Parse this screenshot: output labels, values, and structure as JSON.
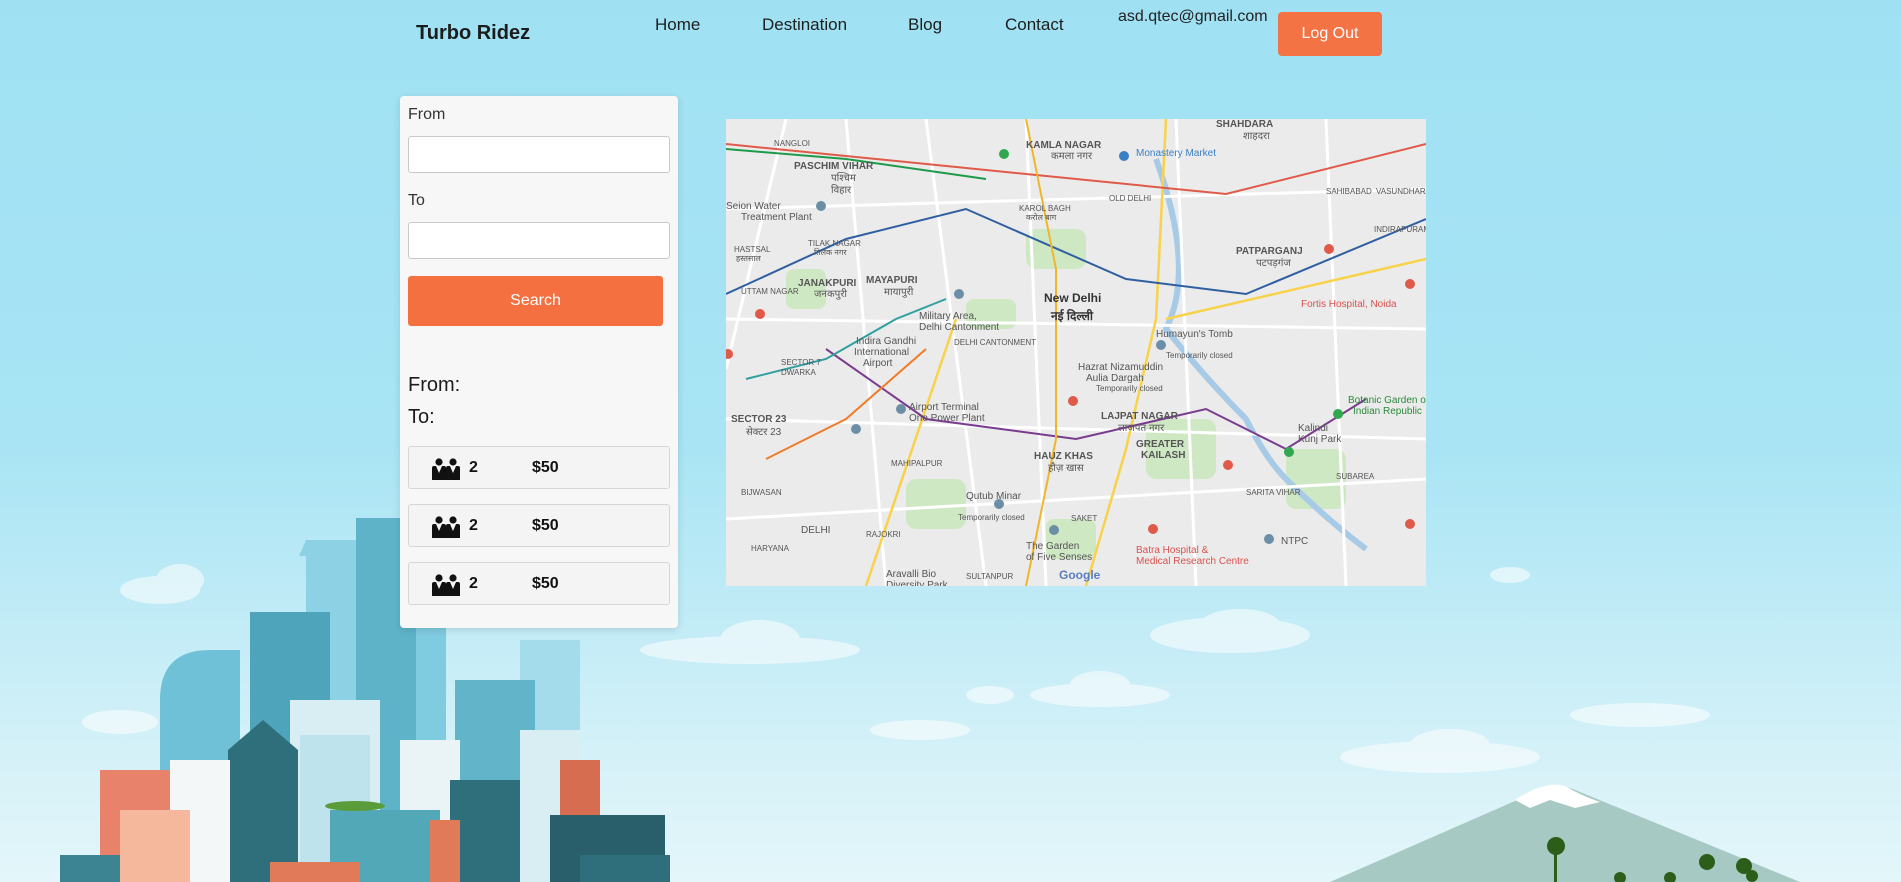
{
  "header": {
    "brand": "Turbo Ridez",
    "nav": [
      "Home",
      "Destination",
      "Blog",
      "Contact"
    ],
    "user_email": "asd.qtec@gmail.com",
    "logout_label": "Log Out"
  },
  "search_form": {
    "from_label": "From",
    "from_value": "",
    "to_label": "To",
    "to_value": "",
    "search_label": "Search",
    "accent_color": "#f47040"
  },
  "summary": {
    "from_label": "From:",
    "to_label": "To:"
  },
  "rides": [
    {
      "icon": "passengers-icon",
      "seats": "2",
      "price": "$50"
    },
    {
      "icon": "passengers-icon",
      "seats": "2",
      "price": "$50"
    },
    {
      "icon": "passengers-icon",
      "seats": "2",
      "price": "$50"
    }
  ],
  "map": {
    "labels": [
      {
        "text": "SHAHDARA"
      },
      {
        "text": "शाहदरा"
      },
      {
        "text": "KAMLA NAGAR"
      },
      {
        "text": "कमला नगर"
      },
      {
        "text": "Monastery Market"
      },
      {
        "text": "PASCHIM VIHAR"
      },
      {
        "text": "पश्चिम"
      },
      {
        "text": "विहार"
      },
      {
        "text": "Seion Water"
      },
      {
        "text": "Treatment Plant"
      },
      {
        "text": "KAROL BAGH"
      },
      {
        "text": "करोल बाग"
      },
      {
        "text": "TILAK NAGAR"
      },
      {
        "text": "तिलक नगर"
      },
      {
        "text": "HASTSAL"
      },
      {
        "text": "हस्तसाल"
      },
      {
        "text": "JANAKPURI"
      },
      {
        "text": "जनकपुरी"
      },
      {
        "text": "MAYAPURI"
      },
      {
        "text": "मायापुरी"
      },
      {
        "text": "PATPARGANJ"
      },
      {
        "text": "पटपड़गंज"
      },
      {
        "text": "New Delhi"
      },
      {
        "text": "नई दिल्ली"
      },
      {
        "text": "Military Area,"
      },
      {
        "text": "Delhi Cantonment"
      },
      {
        "text": "Humayun's Tomb"
      },
      {
        "text": "Temporarily closed"
      },
      {
        "text": "Fortis Hospital, Noida"
      },
      {
        "text": "UTTAM NAGAR"
      },
      {
        "text": "Indira Gandhi"
      },
      {
        "text": "International"
      },
      {
        "text": "Airport"
      },
      {
        "text": "DELHI CANTONMENT"
      },
      {
        "text": "Hazrat Nizamuddin"
      },
      {
        "text": "Aulia Dargah"
      },
      {
        "text": "Temporarily closed"
      },
      {
        "text": "SECTOR 7"
      },
      {
        "text": "DWARKA"
      },
      {
        "text": "Airport Terminal"
      },
      {
        "text": "One Power Plant"
      },
      {
        "text": "LAJPAT NAGAR"
      },
      {
        "text": "लाजपत नगर"
      },
      {
        "text": "Botanic Garden of"
      },
      {
        "text": "Indian Republic"
      },
      {
        "text": "SECTOR 23"
      },
      {
        "text": "सेक्टर 23"
      },
      {
        "text": "Kalindi"
      },
      {
        "text": "Kunj Park"
      },
      {
        "text": "HAUZ KHAS"
      },
      {
        "text": "हौज़ खास"
      },
      {
        "text": "GREATER"
      },
      {
        "text": "KAILASH"
      },
      {
        "text": "MAHIPALPUR"
      },
      {
        "text": "SARITA VIHAR"
      },
      {
        "text": "BIJWASAN"
      },
      {
        "text": "Qutub Minar"
      },
      {
        "text": "Temporarily closed"
      },
      {
        "text": "SAKET"
      },
      {
        "text": "NTPC"
      },
      {
        "text": "SUBAREA"
      },
      {
        "text": "DELHI"
      },
      {
        "text": "RAJOKRI"
      },
      {
        "text": "HARYANA"
      },
      {
        "text": "The Garden"
      },
      {
        "text": "of Five Senses"
      },
      {
        "text": "Batra Hospital &"
      },
      {
        "text": "Medical Research Centre"
      },
      {
        "text": "Aravalli Bio"
      },
      {
        "text": "Diversity Park"
      },
      {
        "text": "SULTANPUR"
      },
      {
        "text": "NANGLOI"
      },
      {
        "text": "OLD DELHI"
      },
      {
        "text": "SAHIBABAD"
      },
      {
        "text": "VASUNDHARA"
      },
      {
        "text": "INDIRAPURAM"
      }
    ],
    "attribution": "Google"
  }
}
